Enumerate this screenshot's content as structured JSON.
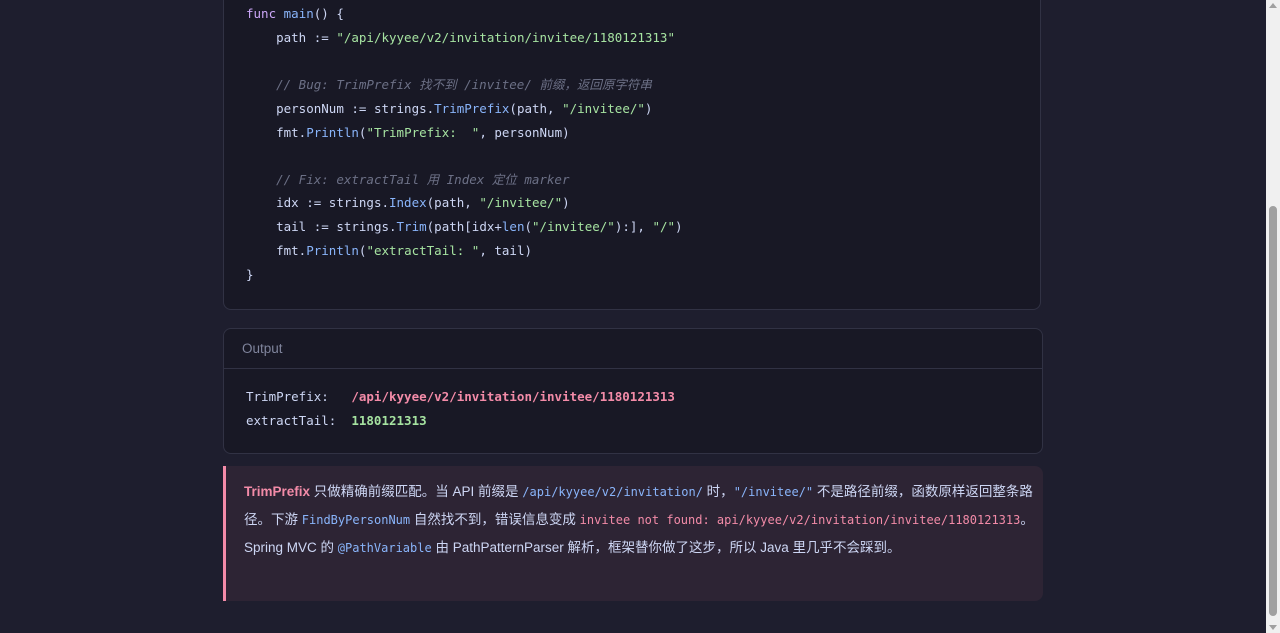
{
  "code": {
    "func_kw": "func",
    "main_fn": "main",
    "main_rest": "() {",
    "path_lhs": "path := ",
    "path_str": "\"/api/kyyee/v2/invitation/invitee/1180121313\"",
    "bug_comment": "// Bug: TrimPrefix 找不到 /invitee/ 前缀，返回原字符串",
    "person_lhs": "personNum := strings.",
    "person_fn": "TrimPrefix",
    "person_args": "(path, ",
    "person_str": "\"/invitee/\"",
    "person_close": ")",
    "println1_pre": "fmt.",
    "println1_fn": "Println",
    "println1_open": "(",
    "println1_str": "\"TrimPrefix:  \"",
    "println1_rest": ", personNum)",
    "fix_comment": "// Fix: extractTail 用 Index 定位 marker",
    "idx_lhs": "idx := strings.",
    "idx_fn": "Index",
    "idx_args": "(path, ",
    "idx_str": "\"/invitee/\"",
    "idx_close": ")",
    "tail_lhs": "tail := strings.",
    "tail_fn": "Trim",
    "tail_mid": "(path[idx+",
    "tail_len": "len",
    "tail_open": "(",
    "tail_str1": "\"/invitee/\"",
    "tail_mid2": "):], ",
    "tail_str2": "\"/\"",
    "tail_close": ")",
    "println2_pre": "fmt.",
    "println2_fn": "Println",
    "println2_open": "(",
    "println2_str": "\"extractTail: \"",
    "println2_rest": ", tail)",
    "closing_brace": "}"
  },
  "output": {
    "title": "Output",
    "line1_label": "TrimPrefix:   ",
    "line1_value": "/api/kyyee/v2/invitation/invitee/1180121313",
    "line2_label": "extractTail:  ",
    "line2_value": "1180121313"
  },
  "note": {
    "strong": "TrimPrefix",
    "t1": " 只做精确前缀匹配。当 API 前缀是 ",
    "code1": "/api/kyyee/v2/invitation/",
    "t2": " 时，",
    "code2": "\"/invitee/\"",
    "t3": " 不是路径前缀，函数原样返回整条路径。下游 ",
    "code3": "FindByPersonNum",
    "t4": " 自然找不到，错误信息变成 ",
    "err": "invitee not found: api/kyyee/v2/invitation/invitee/1180121313",
    "t5": "。Spring MVC 的 ",
    "code4": "@PathVariable",
    "t6": " 由 PathPatternParser 解析，框架替你做了这步，所以 Java 里几乎不会踩到。"
  },
  "colors": {
    "background": "#1e1e2e",
    "card": "#181825",
    "keyword": "#cba6f7",
    "function": "#89b4fa",
    "string": "#a6e3a1",
    "comment": "#6c7086",
    "error": "#f38ba8",
    "note_bg": "#2d2434"
  }
}
